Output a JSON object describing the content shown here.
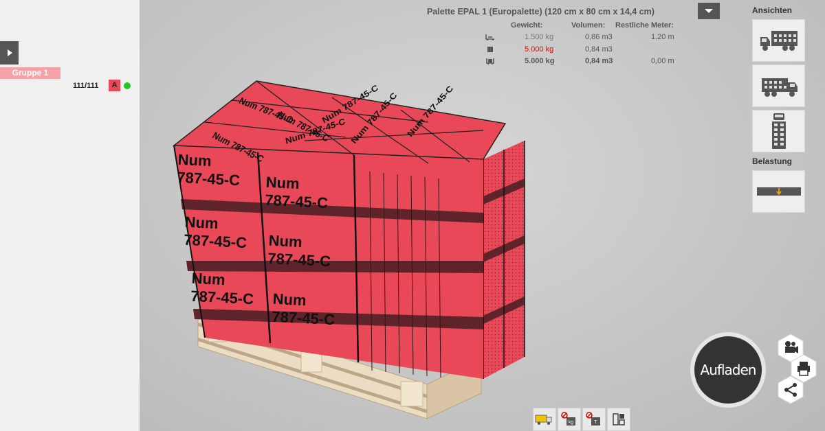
{
  "sidebar": {
    "group_name": "Gruppe 1",
    "group_count": "111/111",
    "group_badge": "A",
    "status_color": "#27c427"
  },
  "pallet": {
    "title": "Palette EPAL 1 (Europalette) (120 cm x 80 cm x 14,4 cm)",
    "headers": {
      "weight": "Gewicht:",
      "volume": "Volumen:",
      "remaining": "Restliche Meter:"
    },
    "rows": [
      {
        "icon": "pallet-load-icon",
        "weight": "1.500 kg",
        "volume": "0,86 m3",
        "remaining": "1,20 m",
        "bold": false,
        "weight_color": "#777777"
      },
      {
        "icon": "max-load-icon",
        "weight": "5.000 kg",
        "volume": "0,84 m3",
        "remaining": "",
        "bold": false,
        "weight_color": "#cc1111"
      },
      {
        "icon": "total-load-icon",
        "weight": "5.000 kg",
        "volume": "0,84 m3",
        "remaining": "0,00 m",
        "bold": true,
        "weight_color": "#555555"
      }
    ]
  },
  "box_label": {
    "line1": "Num",
    "line2": "787-45-C"
  },
  "right_panel": {
    "views_title": "Ansichten",
    "views": [
      "truck-side-icon",
      "truck-angled-icon",
      "truck-top-icon"
    ],
    "load_title": "Belastung",
    "load_icon": "load-distribution-icon"
  },
  "load_button": {
    "label": "Aufladen"
  },
  "side_actions": [
    "camera-icon",
    "print-icon",
    "share-icon"
  ],
  "bottom_toolbar": [
    "truck-load-icon",
    "no-weight-icon",
    "no-height-icon",
    "layout-icon"
  ],
  "colors": {
    "box": "#e84857",
    "box_dark": "#6a2a2e",
    "accent": "#f4a1a7"
  }
}
